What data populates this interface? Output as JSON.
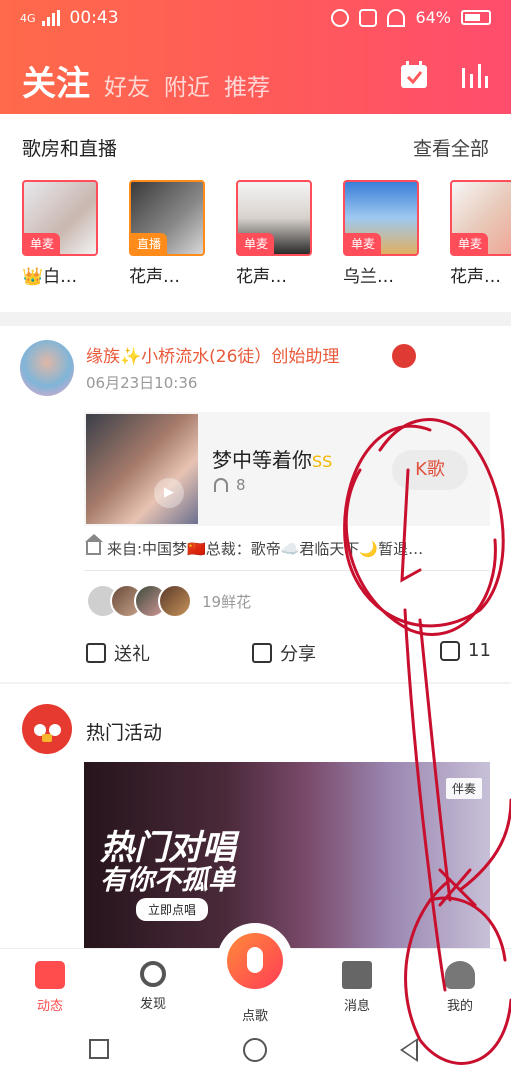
{
  "status_bar": {
    "network": "4G",
    "time": "00:43",
    "battery": "64%"
  },
  "header": {
    "tabs": [
      "关注",
      "好友",
      "附近",
      "推荐"
    ],
    "icons": [
      "calendar-check-icon",
      "bar-chart-icon"
    ]
  },
  "live": {
    "title": "歌房和直播",
    "more": "查看全部",
    "rooms": [
      {
        "tag": "单麦",
        "name": "👑白…"
      },
      {
        "tag": "直播",
        "name": "花声…"
      },
      {
        "tag": "单麦",
        "name": "花声…"
      },
      {
        "tag": "单麦",
        "name": "乌兰…"
      },
      {
        "tag": "单麦",
        "name": "花声…"
      }
    ]
  },
  "post": {
    "author_prefix": "缘族",
    "author_name": "小桥流水(26徒）创始助理",
    "time": "06月23日10:36",
    "song_title": "梦中等着你",
    "song_badge": "SS",
    "plays": "8",
    "k_button": "K歌",
    "source": "来自:中国梦🇨🇳总裁：歌帝☁️君临天下🌙暂退…",
    "flowers": "19鲜花",
    "actions": {
      "gift": "送礼",
      "share": "分享",
      "comments": "11"
    }
  },
  "activity": {
    "title": "热门活动",
    "banner_line1": "热门对唱",
    "banner_line2": "有你不孤单",
    "banner_button": "立即点唱",
    "banner_tag": "伴奏"
  },
  "bottom_nav": {
    "items": [
      "动态",
      "发现",
      "点歌",
      "消息",
      "我的"
    ],
    "active": "动态"
  },
  "colors": {
    "accent": "#ff4d4d",
    "header_start": "#ff6a4a",
    "header_end": "#ff4d6d",
    "scribble": "#c8102e"
  }
}
